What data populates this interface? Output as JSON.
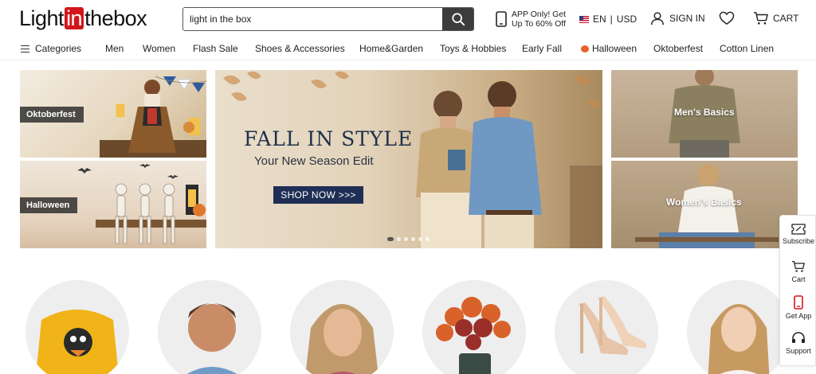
{
  "header": {
    "logo": {
      "before": "Light",
      "highlight": "in",
      "after": "thebox"
    },
    "search": {
      "value": "light in the box",
      "placeholder": ""
    },
    "app_promo": {
      "line1": "APP Only! Get",
      "line2": "Up To 60% Off"
    },
    "language": "EN",
    "currency": "USD",
    "signin_label": "SIGN IN",
    "cart_label": "CART"
  },
  "nav": {
    "categories_label": "Categories",
    "items": [
      "Men",
      "Women",
      "Flash Sale",
      "Shoes & Accessories",
      "Home&Garden",
      "Toys & Hobbies",
      "Early Fall",
      "Halloween",
      "Oktoberfest",
      "Cotton Linen"
    ]
  },
  "banners": {
    "left_top_label": "Oktoberfest",
    "left_bottom_label": "Halloween",
    "hero": {
      "title": "FALL IN STYLE",
      "subtitle": "Your New Season Edit",
      "cta": "SHOP NOW >>>",
      "slide_count": 6,
      "active_slide": 1
    },
    "right_top_label": "Men's Basics",
    "right_bottom_label": "Women's Basics"
  },
  "sidebar": {
    "subscribe": "Subscribe",
    "cart": "Cart",
    "get_app": "Get App",
    "support": "Support"
  },
  "colors": {
    "brand_red": "#d3161c",
    "search_button": "#3c3c3c",
    "hero_cta": "#1f2e55"
  }
}
